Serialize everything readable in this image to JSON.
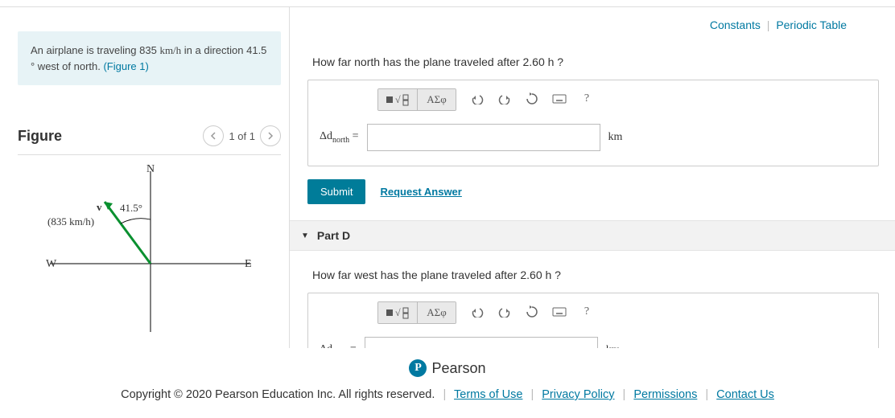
{
  "top_links": {
    "constants": "Constants",
    "periodic": "Periodic Table"
  },
  "problem": {
    "text_a": "An airplane is traveling 835 ",
    "unit_a": "km/h",
    "text_b": " in a direction 41.5 ° west of north. ",
    "fig_link": "(Figure 1)"
  },
  "figure": {
    "title": "Figure",
    "pager": "1 of 1",
    "labels": {
      "n": "N",
      "e": "E",
      "w": "W"
    },
    "angle": "41.5°",
    "speed": "(835 km/h)",
    "vec": "v⃗"
  },
  "partC": {
    "question": "How far north has the plane traveled after 2.60 h ?",
    "lhs_sym": "Δd",
    "lhs_sub": "north",
    "eq": " =",
    "unit": "km",
    "submit": "Submit",
    "req": "Request Answer",
    "tb_greek": "ΑΣφ"
  },
  "partD": {
    "header": "Part D",
    "question": "How far west has the plane traveled after 2.60 h ?",
    "lhs_sym": "Δd",
    "lhs_sub": "west",
    "eq": " =",
    "unit": "km",
    "tb_greek": "ΑΣφ"
  },
  "footer": {
    "pearson": "Pearson",
    "copy": "Copyright © 2020 Pearson Education Inc. All rights reserved.",
    "links": {
      "terms": "Terms of Use",
      "privacy": "Privacy Policy",
      "perm": "Permissions",
      "contact": "Contact Us"
    }
  }
}
